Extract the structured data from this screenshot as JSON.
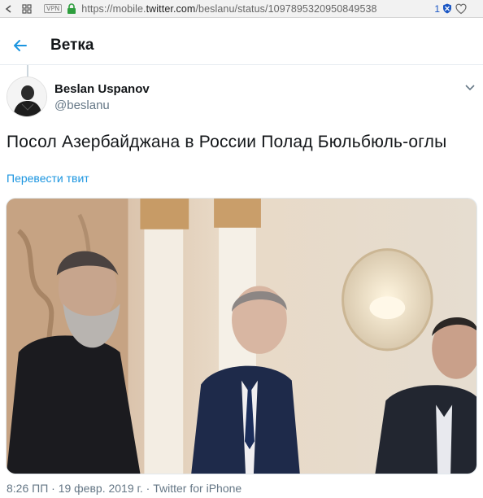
{
  "browser": {
    "vpn_label": "VPN",
    "url_prefix": "https://mobile.",
    "url_host": "twitter.com",
    "url_path": "/beslanu/status/1097895320950849538",
    "tab_count": "1",
    "icons": [
      "grid-icon",
      "lock-icon",
      "shield-icon",
      "heart-icon"
    ]
  },
  "header": {
    "title": "Ветка",
    "back_icon": "back-arrow-icon",
    "accent_color": "#1b95e0"
  },
  "tweet": {
    "author_name": "Beslan Uspanov",
    "author_handle": "@beslanu",
    "text": "Посол Азербайджана в России Полад Бюльбюль-оглы",
    "translate_label": "Перевести твит",
    "timestamp": "8:26 ПП · 19 февр. 2019 г. · Twitter for iPhone",
    "media_type": "video-frame"
  }
}
